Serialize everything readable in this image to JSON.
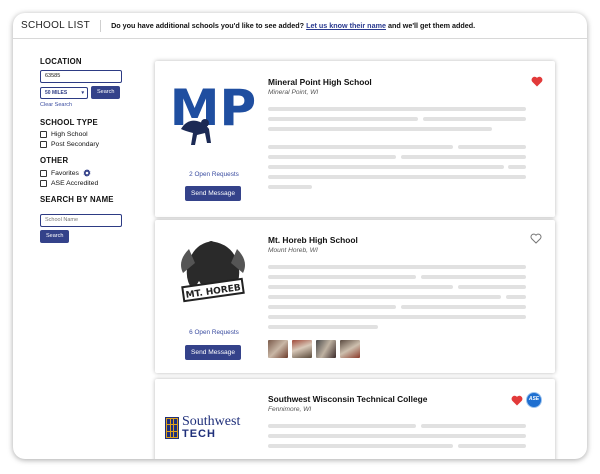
{
  "header": {
    "title": "SCHOOL LIST",
    "banner_text": "Do you have additional schools you'd like to see added?",
    "banner_link": "Let us know their name",
    "banner_suffix": "and we'll get them added."
  },
  "sidebar": {
    "location_heading": "LOCATION",
    "zip_value": "63585",
    "distance_selected": "50 MILES",
    "search_button": "Search",
    "clear_link": "Clear Search",
    "school_type_heading": "SCHOOL TYPE",
    "school_types": [
      "High School",
      "Post Secondary"
    ],
    "other_heading": "OTHER",
    "other_favorites": "Favorites",
    "other_ase": "ASE Accredited",
    "search_name_heading": "SEARCH BY NAME",
    "name_placeholder": "School Name",
    "name_search_button": "Search"
  },
  "schools": [
    {
      "name": "Mineral Point High School",
      "location": "Mineral Point, WI",
      "requests": "2 Open Requests",
      "send_label": "Send Message",
      "favorite": true,
      "logo_text": "MP"
    },
    {
      "name": "Mt. Horeb High School",
      "location": "Mount Horeb, WI",
      "requests": "6 Open Requests",
      "send_label": "Send Message",
      "favorite": false,
      "logo_text": "MT. HOREB"
    },
    {
      "name": "Southwest Wisconsin Technical College",
      "location": "Fennimore, WI",
      "favorite": true,
      "badge": "ASE",
      "logo_line1": "Southwest",
      "logo_line2": "TECH"
    }
  ],
  "colors": {
    "primary": "#34428a",
    "link": "#3a4ca0",
    "heart_red": "#e23a3a",
    "placeholder_bar": "#e1e1e1"
  }
}
